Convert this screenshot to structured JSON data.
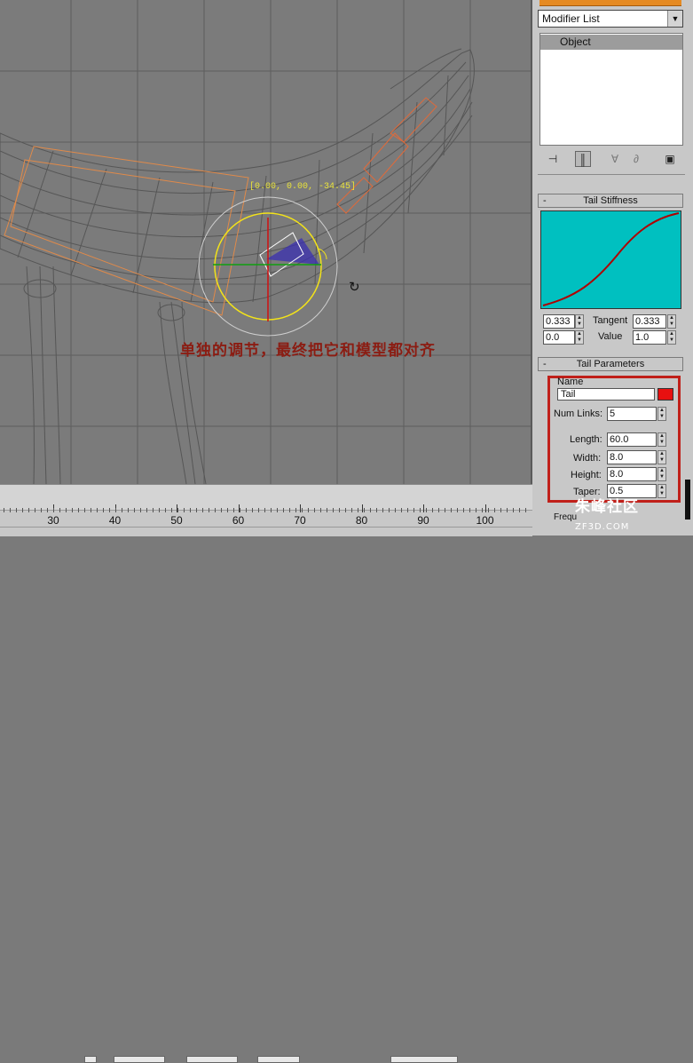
{
  "viewport": {
    "coord_readout": "[0.00, 0.00, -34.45]",
    "caption": "单独的调节，最终把它和模型都对齐",
    "cursor_icon": "rotate-cursor-icon"
  },
  "timeline": {
    "ticks": [
      "30",
      "40",
      "50",
      "60",
      "70",
      "80",
      "90",
      "100"
    ]
  },
  "modifier_panel": {
    "modifier_list_label": "Modifier List",
    "stack_items": [
      "Object"
    ],
    "toolbar_icons": [
      "pin-stack-icon",
      "show-end-result-icon",
      "make-unique-icon",
      "remove-modifier-icon",
      "configure-sets-icon"
    ]
  },
  "tail_stiffness": {
    "title": "Tail Stiffness",
    "curve_color": "#b00000",
    "curve_bg": "#00c0c0",
    "field_left_top": "0.333",
    "tangent_label": "Tangent",
    "field_right_top": "0.333",
    "field_left_bottom": "0.0",
    "value_label": "Value",
    "field_right_bottom": "1.0"
  },
  "tail_parameters": {
    "title": "Tail Parameters",
    "name_label": "Name",
    "name_value": "Tail",
    "swatch_color": "#e81010",
    "num_links_label": "Num Links:",
    "num_links_value": "5",
    "length_label": "Length:",
    "length_value": "60.0",
    "width_label": "Width:",
    "width_value": "8.0",
    "height_label": "Height:",
    "height_value": "8.0",
    "taper_label": "Taper:",
    "taper_value": "0.5",
    "freq_label_partial": "Frequ"
  },
  "watermark": {
    "brand": "朱峰社区",
    "site": "ZF3D.COM"
  }
}
